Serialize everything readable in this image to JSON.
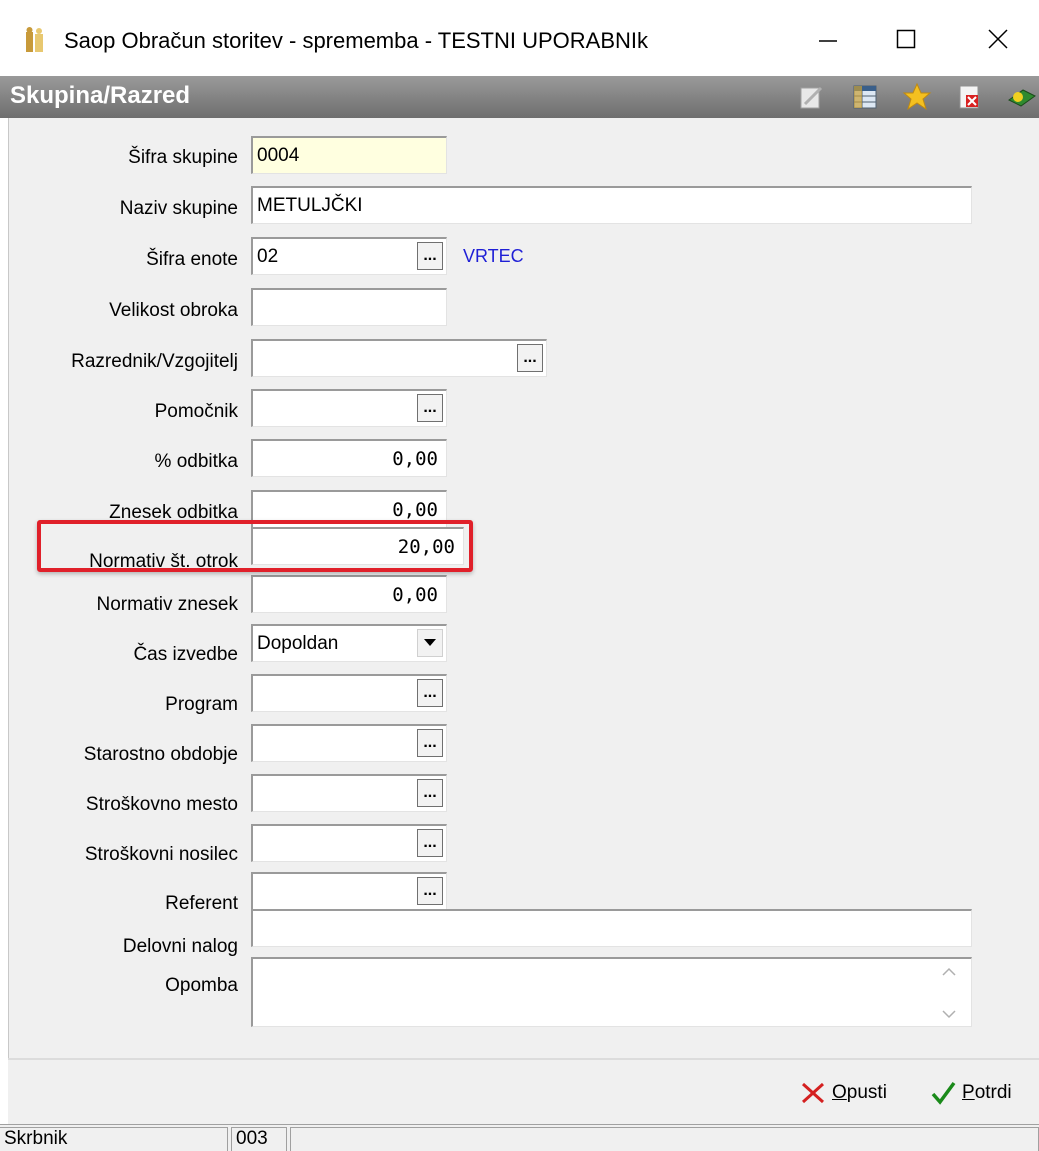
{
  "window": {
    "title": "Saop Obračun storitev - sprememba - TESTNI UPORABNIk",
    "minimize": "—",
    "maximize": "☐",
    "close": "✕"
  },
  "header": {
    "title": "Skupina/Razred",
    "toolbar_icons": [
      "edit-icon",
      "grid-icon",
      "favorite-star-icon",
      "close-document-icon",
      "help-book-icon"
    ]
  },
  "form": {
    "sifra_skupine": {
      "label": "Šifra skupine",
      "value": "0004"
    },
    "naziv_skupine": {
      "label": "Naziv skupine",
      "value": "METULJČKI"
    },
    "sifra_enote": {
      "label": "Šifra enote",
      "value": "02",
      "lookup_text": "VRTEC"
    },
    "velikost_obroka": {
      "label": "Velikost obroka",
      "value": ""
    },
    "razrednik": {
      "label": "Razrednik/Vzgojitelj",
      "value": ""
    },
    "pomocnik": {
      "label": "Pomočnik",
      "value": ""
    },
    "odbitek_pct": {
      "label": "% odbitka",
      "value": "0,00"
    },
    "znesek_odbitka": {
      "label": "Znesek odbitka",
      "value": "0,00"
    },
    "normativ_otrok": {
      "label": "Normativ št. otrok",
      "value": "20,00"
    },
    "normativ_znesek": {
      "label": "Normativ znesek",
      "value": "0,00"
    },
    "cas_izvedbe": {
      "label": "Čas izvedbe",
      "value": "Dopoldan"
    },
    "program": {
      "label": "Program",
      "value": ""
    },
    "starostno_obdobje": {
      "label": "Starostno obdobje",
      "value": ""
    },
    "stroskovno_mesto": {
      "label": "Stroškovno mesto",
      "value": ""
    },
    "stroskovni_nosilec": {
      "label": "Stroškovni nosilec",
      "value": ""
    },
    "referent": {
      "label": "Referent",
      "value": ""
    },
    "delovni_nalog": {
      "label": "Delovni nalog",
      "value": ""
    },
    "opomba": {
      "label": "Opomba",
      "value": ""
    }
  },
  "lookup_button_text": "...",
  "footer": {
    "cancel_first": "O",
    "cancel_rest": "pusti",
    "confirm_first": "P",
    "confirm_rest": "otrdi"
  },
  "statusbar": {
    "cell1": "Skrbnik",
    "cell2": "003",
    "cell3": ""
  },
  "colors": {
    "header_bg": "#808080",
    "highlight": "#e0202a",
    "link": "#1f1fd6",
    "yellow_field": "#ffffe0",
    "cancel_icon": "#d42020",
    "confirm_icon": "#1a8a1a"
  }
}
